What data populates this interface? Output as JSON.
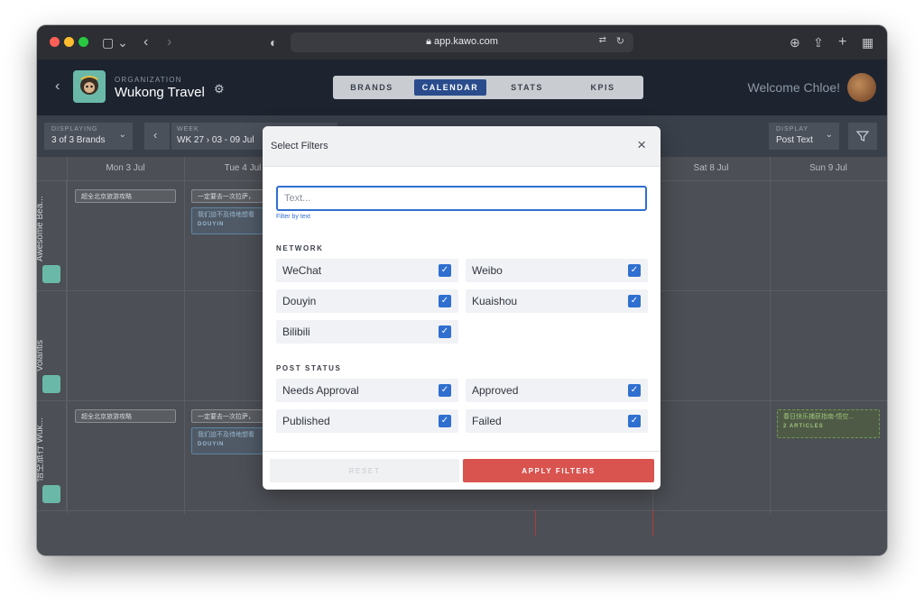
{
  "browser": {
    "url": "app.kawo.com"
  },
  "header": {
    "org_label": "ORGANIZATION",
    "org_name": "Wukong Travel",
    "tabs": [
      {
        "label": "BRANDS",
        "active": false
      },
      {
        "label": "CALENDAR",
        "active": true
      },
      {
        "label": "STATS",
        "active": false
      },
      {
        "label": "KPIS",
        "active": false
      }
    ],
    "welcome": "Welcome Chloe!"
  },
  "toolbar": {
    "displaying_label": "DISPLAYING",
    "displaying_value": "3 of 3 Brands",
    "week_label": "WEEK",
    "week_value": "WK 27 › 03 - 09 Jul",
    "display_label": "DISPLAY",
    "display_value": "Post Text"
  },
  "calendar": {
    "days": [
      "Mon 3 Jul",
      "Tue 4 Jul",
      "Sat 8 Jul",
      "Sun 9 Jul"
    ],
    "brands": [
      "Awesome Bea...",
      "Volantis",
      "悟空旅行 Wuk..."
    ],
    "posts": {
      "mon_row1": "超全北京旅游攻略",
      "tue_row1_a": "一定要去一次拉萨，",
      "tue_row1_b": "我们迫不及待地想看",
      "tue_row1_b_net": "DOUYIN",
      "mon_row3": "超全北京旅游攻略",
      "tue_row3_a": "一定要去一次拉萨，",
      "tue_row3_b": "我们迫不及待地想看",
      "tue_row3_b_net": "DOUYIN",
      "sun_row3": "春日快乐捕获指南-悟空...",
      "sun_row3_count": "2 ARTICLES"
    }
  },
  "modal": {
    "title": "Select Filters",
    "search_placeholder": "Text...",
    "search_hint": "Filter by text",
    "network_title": "NETWORK",
    "networks": [
      {
        "label": "WeChat",
        "checked": true
      },
      {
        "label": "Weibo",
        "checked": true
      },
      {
        "label": "Douyin",
        "checked": true
      },
      {
        "label": "Kuaishou",
        "checked": true
      },
      {
        "label": "Bilibili",
        "checked": true
      }
    ],
    "status_title": "POST STATUS",
    "statuses": [
      {
        "label": "Needs Approval",
        "checked": true
      },
      {
        "label": "Approved",
        "checked": true
      },
      {
        "label": "Published",
        "checked": true
      },
      {
        "label": "Failed",
        "checked": true
      }
    ],
    "reset_label": "RESET",
    "apply_label": "APPLY FILTERS",
    "check_glyph": "✓"
  },
  "colors": {
    "accent": "#2f6fd0",
    "apply": "#d9534f",
    "nav_active": "#2a4c8c"
  }
}
